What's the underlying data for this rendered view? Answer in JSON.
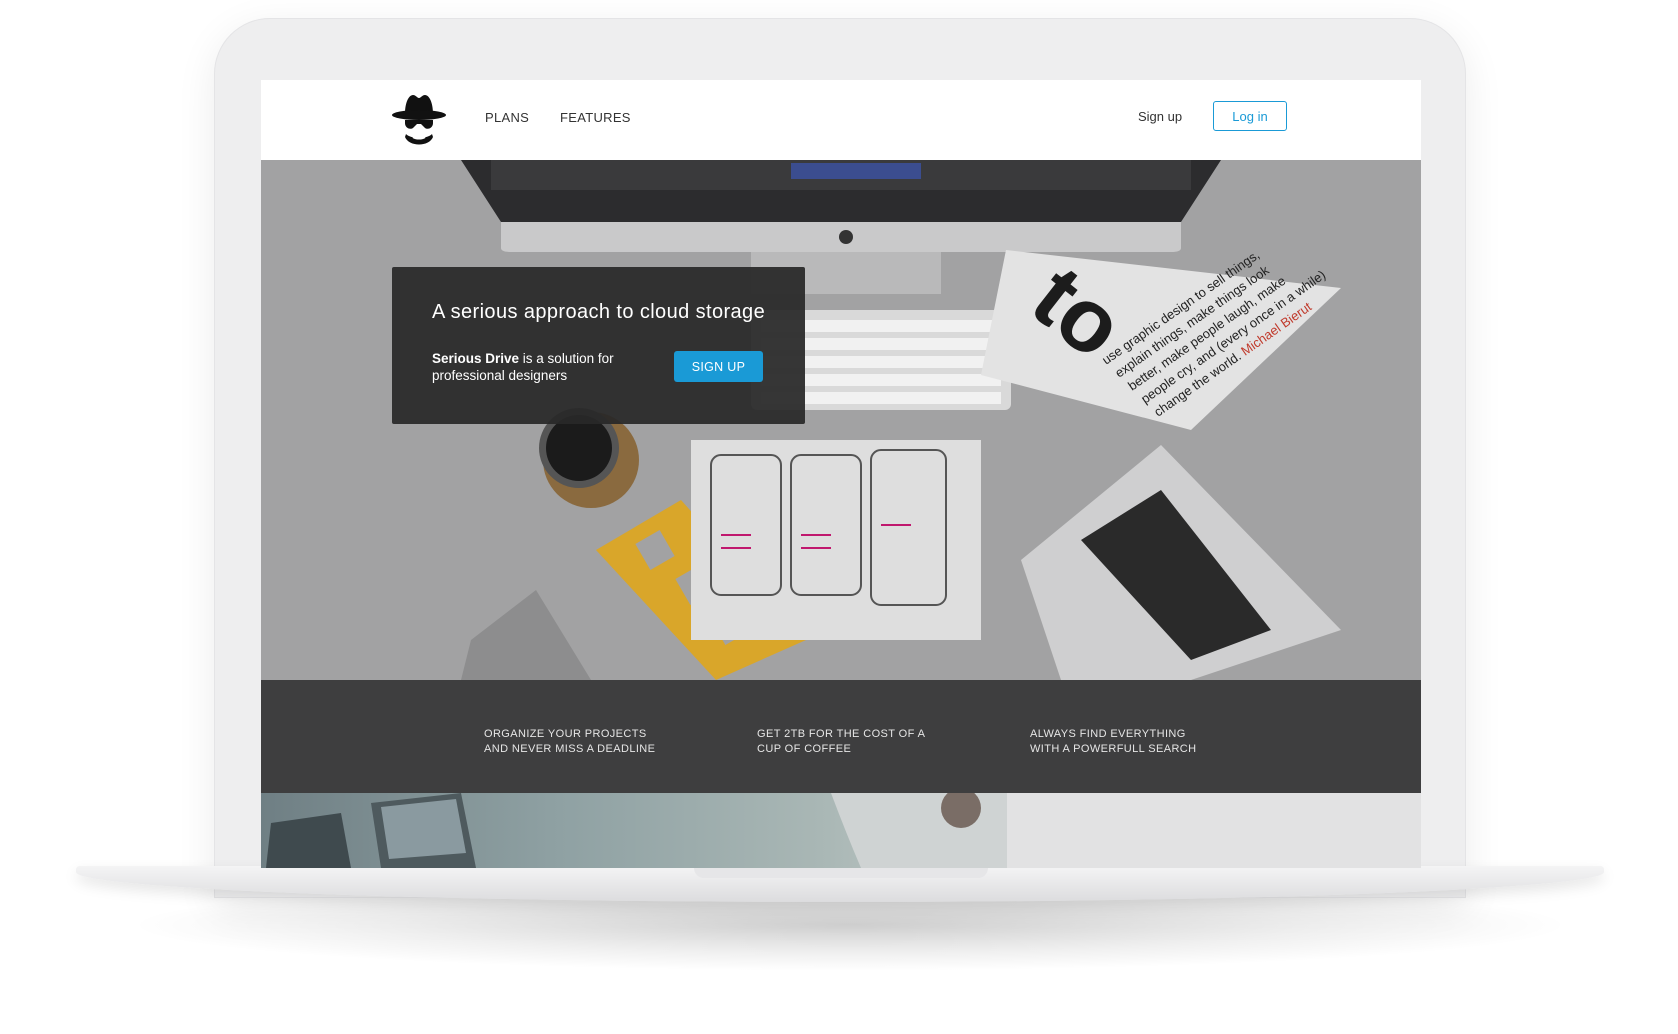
{
  "nav": {
    "links": [
      {
        "label": "PLANS"
      },
      {
        "label": "FEATURES"
      }
    ],
    "signup_label": "Sign up",
    "login_label": "Log in"
  },
  "hero": {
    "title": "A serious approach to cloud storage",
    "brand": "Serious Drive",
    "description": " is a solution for professional designers",
    "signup_button": "SIGN UP"
  },
  "features": [
    {
      "line1": "ORGANIZE YOUR PROJECTS",
      "line2": "AND NEVER MISS A DEADLINE"
    },
    {
      "line1": "GET 2TB FOR THE COST OF A",
      "line2": "CUP OF COFFEE"
    },
    {
      "line1": "ALWAYS FIND EVERYTHING",
      "line2": "WITH A POWERFULL SEARCH"
    }
  ],
  "colors": {
    "accent": "#1a9ad6",
    "hero_card": "#282828",
    "features_band": "#3e3e3f"
  }
}
